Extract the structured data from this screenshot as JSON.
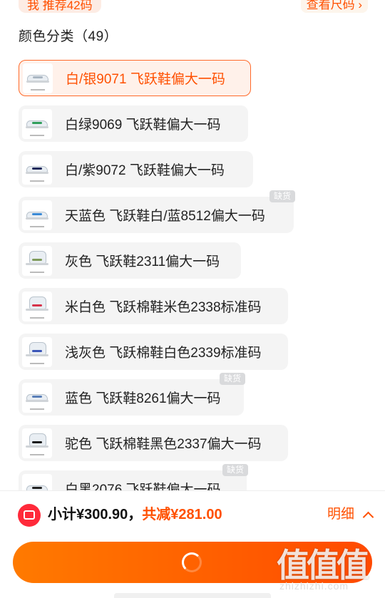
{
  "header": {
    "recommend_badge": "我 推荐42码",
    "size_link": "查看尺码 ›"
  },
  "section": {
    "title": "颜色分类（49）"
  },
  "skus": [
    {
      "label": "白/银9071 飞跃鞋偏大一码",
      "selected": true,
      "out_of_stock": false,
      "accent": "#aab6c2"
    },
    {
      "label": "白绿9069 飞跃鞋偏大一码",
      "selected": false,
      "out_of_stock": false,
      "accent": "#2f9e5b"
    },
    {
      "label": "白/紫9072 飞跃鞋偏大一码",
      "selected": false,
      "out_of_stock": false,
      "accent": "#1f2a5a"
    },
    {
      "label": "天蓝色 飞跃鞋白/蓝8512偏大一码",
      "selected": false,
      "out_of_stock": true,
      "accent": "#3a8ad6"
    },
    {
      "label": "灰色 飞跃鞋2311偏大一码",
      "selected": false,
      "out_of_stock": false,
      "accent": "#7e9a5a"
    },
    {
      "label": "米白色 飞跃棉鞋米色2338标准码",
      "selected": false,
      "out_of_stock": false,
      "accent": "#d6334a"
    },
    {
      "label": "浅灰色 飞跃棉鞋白色2339标准码",
      "selected": false,
      "out_of_stock": false,
      "accent": "#3b56b8"
    },
    {
      "label": "蓝色 飞跃鞋8261偏大一码",
      "selected": false,
      "out_of_stock": true,
      "accent": "#5a7fb8"
    },
    {
      "label": "驼色 飞跃棉鞋黑色2337偏大一码",
      "selected": false,
      "out_of_stock": false,
      "accent": "#1b1b1b"
    },
    {
      "label": "白黑2076 飞跃鞋偏大一码",
      "selected": false,
      "out_of_stock": true,
      "accent": "#222222"
    }
  ],
  "oos_label": "缺货",
  "footer": {
    "subtotal": "小计¥300.90，",
    "discount": "共减¥281.00",
    "detail": "明细"
  },
  "watermark": {
    "text": "值值值",
    "url": "zhizhizhi.com"
  },
  "colors": {
    "accent": "#ff5000",
    "coupon": "#ff2a3a",
    "button_start": "#ff7a00",
    "button_end": "#ff4a00"
  }
}
